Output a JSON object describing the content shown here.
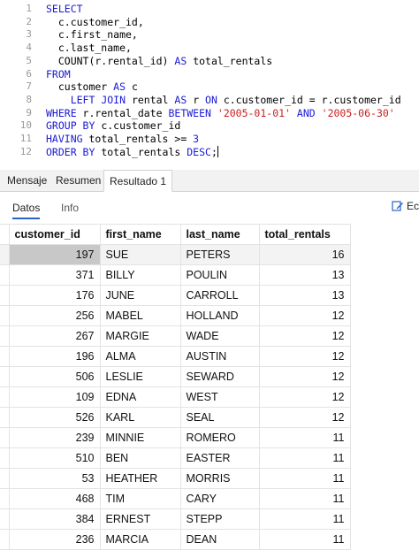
{
  "editor": {
    "line_numbers": [
      "1",
      "2",
      "3",
      "4",
      "5",
      "6",
      "7",
      "8",
      "9",
      "10",
      "11",
      "12"
    ],
    "lines": [
      [
        {
          "t": "SELECT",
          "c": "kw"
        }
      ],
      [
        {
          "t": "  c.customer_id,",
          "c": ""
        }
      ],
      [
        {
          "t": "  c.first_name,",
          "c": ""
        }
      ],
      [
        {
          "t": "  c.last_name,",
          "c": ""
        }
      ],
      [
        {
          "t": "  COUNT(r.rental_id) ",
          "c": ""
        },
        {
          "t": "AS",
          "c": "kw"
        },
        {
          "t": " total_rentals",
          "c": ""
        }
      ],
      [
        {
          "t": "FROM",
          "c": "kw"
        }
      ],
      [
        {
          "t": "  customer ",
          "c": ""
        },
        {
          "t": "AS",
          "c": "kw"
        },
        {
          "t": " c",
          "c": ""
        }
      ],
      [
        {
          "t": "    ",
          "c": ""
        },
        {
          "t": "LEFT JOIN",
          "c": "kw"
        },
        {
          "t": " rental ",
          "c": ""
        },
        {
          "t": "AS",
          "c": "kw"
        },
        {
          "t": " r ",
          "c": ""
        },
        {
          "t": "ON",
          "c": "kw"
        },
        {
          "t": " c.customer_id = r.customer_id",
          "c": ""
        }
      ],
      [
        {
          "t": "WHERE",
          "c": "kw"
        },
        {
          "t": " r.rental_date ",
          "c": ""
        },
        {
          "t": "BETWEEN",
          "c": "kw"
        },
        {
          "t": " ",
          "c": ""
        },
        {
          "t": "'2005-01-01'",
          "c": "str"
        },
        {
          "t": " ",
          "c": ""
        },
        {
          "t": "AND",
          "c": "kw"
        },
        {
          "t": " ",
          "c": ""
        },
        {
          "t": "'2005-06-30'",
          "c": "str"
        }
      ],
      [
        {
          "t": "GROUP BY",
          "c": "kw"
        },
        {
          "t": " c.customer_id",
          "c": ""
        }
      ],
      [
        {
          "t": "HAVING",
          "c": "kw"
        },
        {
          "t": " total_rentals >= ",
          "c": ""
        },
        {
          "t": "3",
          "c": "kw"
        }
      ],
      [
        {
          "t": "ORDER BY",
          "c": "kw"
        },
        {
          "t": " total_rentals ",
          "c": ""
        },
        {
          "t": "DESC",
          "c": "kw"
        },
        {
          "t": ";",
          "c": ""
        }
      ]
    ]
  },
  "tabs": {
    "mensaje": "Mensaje",
    "resumen": "Resumen",
    "resultado": "Resultado 1"
  },
  "subtabs": {
    "datos": "Datos",
    "info": "Info",
    "edit_label": "Ec"
  },
  "grid": {
    "columns": [
      "customer_id",
      "first_name",
      "last_name",
      "total_rentals"
    ],
    "rows": [
      [
        "197",
        "SUE",
        "PETERS",
        "16"
      ],
      [
        "371",
        "BILLY",
        "POULIN",
        "13"
      ],
      [
        "176",
        "JUNE",
        "CARROLL",
        "13"
      ],
      [
        "256",
        "MABEL",
        "HOLLAND",
        "12"
      ],
      [
        "267",
        "MARGIE",
        "WADE",
        "12"
      ],
      [
        "196",
        "ALMA",
        "AUSTIN",
        "12"
      ],
      [
        "506",
        "LESLIE",
        "SEWARD",
        "12"
      ],
      [
        "109",
        "EDNA",
        "WEST",
        "12"
      ],
      [
        "526",
        "KARL",
        "SEAL",
        "12"
      ],
      [
        "239",
        "MINNIE",
        "ROMERO",
        "11"
      ],
      [
        "510",
        "BEN",
        "EASTER",
        "11"
      ],
      [
        "53",
        "HEATHER",
        "MORRIS",
        "11"
      ],
      [
        "468",
        "TIM",
        "CARY",
        "11"
      ],
      [
        "384",
        "ERNEST",
        "STEPP",
        "11"
      ],
      [
        "236",
        "MARCIA",
        "DEAN",
        "11"
      ]
    ]
  },
  "colors": {
    "keyword": "#1a1ad6",
    "string": "#c81e1e",
    "accent": "#2a62c9",
    "selected_cell": "#c8c8c8"
  }
}
